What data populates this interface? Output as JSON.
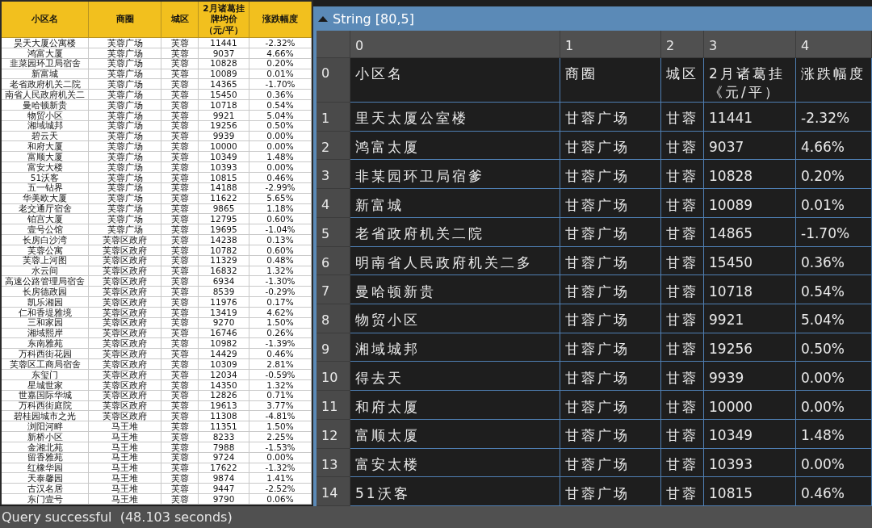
{
  "spreadsheet": {
    "columns": [
      "小区名",
      "商圈",
      "城区",
      "2月诸葛挂牌均价（元/平）",
      "涨跌幅度"
    ],
    "rows": [
      [
        "昊天大厦公寓楼",
        "芙蓉广场",
        "芙蓉",
        "11441",
        "-2.32%"
      ],
      [
        "鸿富大厦",
        "芙蓉广场",
        "芙蓉",
        "9037",
        "4.66%"
      ],
      [
        "韭菜园环卫局宿舍",
        "芙蓉广场",
        "芙蓉",
        "10828",
        "0.20%"
      ],
      [
        "新富城",
        "芙蓉广场",
        "芙蓉",
        "10089",
        "0.01%"
      ],
      [
        "老省政府机关二院",
        "芙蓉广场",
        "芙蓉",
        "14365",
        "-1.70%"
      ],
      [
        "南省人民政府机关二",
        "芙蓉广场",
        "芙蓉",
        "15450",
        "0.36%"
      ],
      [
        "曼哈顿新贵",
        "芙蓉广场",
        "芙蓉",
        "10718",
        "0.54%"
      ],
      [
        "物贸小区",
        "芙蓉广场",
        "芙蓉",
        "9921",
        "5.04%"
      ],
      [
        "湘域城邦",
        "芙蓉广场",
        "芙蓉",
        "19256",
        "0.50%"
      ],
      [
        "碧云天",
        "芙蓉广场",
        "芙蓉",
        "9939",
        "0.00%"
      ],
      [
        "和府大厦",
        "芙蓉广场",
        "芙蓉",
        "10000",
        "0.00%"
      ],
      [
        "富顺大厦",
        "芙蓉广场",
        "芙蓉",
        "10349",
        "1.48%"
      ],
      [
        "富安大楼",
        "芙蓉广场",
        "芙蓉",
        "10393",
        "0.00%"
      ],
      [
        "51沃客",
        "芙蓉广场",
        "芙蓉",
        "10815",
        "0.46%"
      ],
      [
        "五一钻界",
        "芙蓉广场",
        "芙蓉",
        "14188",
        "-2.99%"
      ],
      [
        "华美欧大厦",
        "芙蓉广场",
        "芙蓉",
        "11622",
        "5.65%"
      ],
      [
        "老交通厅宿舍",
        "芙蓉广场",
        "芙蓉",
        "9865",
        "1.18%"
      ],
      [
        "铂宫大厦",
        "芙蓉广场",
        "芙蓉",
        "12795",
        "0.60%"
      ],
      [
        "壹号公馆",
        "芙蓉广场",
        "芙蓉",
        "19695",
        "-1.04%"
      ],
      [
        "长房白沙湾",
        "芙蓉区政府",
        "芙蓉",
        "14238",
        "0.13%"
      ],
      [
        "芙蓉公寓",
        "芙蓉区政府",
        "芙蓉",
        "10782",
        "0.60%"
      ],
      [
        "芙蓉上河图",
        "芙蓉区政府",
        "芙蓉",
        "11329",
        "0.48%"
      ],
      [
        "水云间",
        "芙蓉区政府",
        "芙蓉",
        "16832",
        "1.32%"
      ],
      [
        "高速公路管理局宿舍",
        "芙蓉区政府",
        "芙蓉",
        "6934",
        "-1.30%"
      ],
      [
        "长房德政园",
        "芙蓉区政府",
        "芙蓉",
        "8539",
        "-0.29%"
      ],
      [
        "凯乐湘园",
        "芙蓉区政府",
        "芙蓉",
        "11976",
        "0.17%"
      ],
      [
        "仁和香堤雅境",
        "芙蓉区政府",
        "芙蓉",
        "13419",
        "4.62%"
      ],
      [
        "三和家园",
        "芙蓉区政府",
        "芙蓉",
        "9270",
        "1.50%"
      ],
      [
        "湘域熙岸",
        "芙蓉区政府",
        "芙蓉",
        "16746",
        "0.26%"
      ],
      [
        "东南雅苑",
        "芙蓉区政府",
        "芙蓉",
        "10982",
        "-1.39%"
      ],
      [
        "万科西街花园",
        "芙蓉区政府",
        "芙蓉",
        "14429",
        "0.46%"
      ],
      [
        "芙蓉区工商局宿舍",
        "芙蓉区政府",
        "芙蓉",
        "10309",
        "2.81%"
      ],
      [
        "东玺门",
        "芙蓉区政府",
        "芙蓉",
        "12034",
        "-0.59%"
      ],
      [
        "星城世家",
        "芙蓉区政府",
        "芙蓉",
        "14350",
        "1.32%"
      ],
      [
        "世嘉国际华城",
        "芙蓉区政府",
        "芙蓉",
        "12826",
        "0.71%"
      ],
      [
        "万科西街庭院",
        "芙蓉区政府",
        "芙蓉",
        "19613",
        "3.77%"
      ],
      [
        "碧桂园城市之光",
        "芙蓉区政府",
        "芙蓉",
        "11308",
        "-4.81%"
      ],
      [
        "浏阳河畔",
        "马王堆",
        "芙蓉",
        "11351",
        "1.50%"
      ],
      [
        "新桥小区",
        "马王堆",
        "芙蓉",
        "8233",
        "2.25%"
      ],
      [
        "金湘北苑",
        "马王堆",
        "芙蓉",
        "7988",
        "-1.53%"
      ],
      [
        "留香雅苑",
        "马王堆",
        "芙蓉",
        "9724",
        "0.00%"
      ],
      [
        "红橡华园",
        "马王堆",
        "芙蓉",
        "17622",
        "-1.32%"
      ],
      [
        "天泰馨园",
        "马王堆",
        "芙蓉",
        "9874",
        "1.41%"
      ],
      [
        "古汉名居",
        "马王堆",
        "芙蓉",
        "9447",
        "-2.52%"
      ],
      [
        "东门壹号",
        "马王堆",
        "芙蓉",
        "9790",
        "0.06%"
      ]
    ]
  },
  "result_panel": {
    "title": "String [80,5]",
    "expanded": true,
    "column_indices": [
      "0",
      "1",
      "2",
      "3",
      "4"
    ],
    "rows": [
      {
        "index": "0",
        "cells": [
          "小区名",
          "商圈",
          "城区",
          "2月诸葛挂《元/平）",
          "涨跌幅度"
        ]
      },
      {
        "index": "1",
        "cells": [
          "里天太厦公室楼",
          "甘蓉广场",
          "甘蓉",
          "11441",
          "-2.32%"
        ]
      },
      {
        "index": "2",
        "cells": [
          "鸿富太厦",
          "甘蓉广场",
          "甘蓉",
          "9037",
          "4.66%"
        ]
      },
      {
        "index": "3",
        "cells": [
          "非某园环卫局宿爹",
          "甘蓉广场",
          "甘蓉",
          "10828",
          "0.20%"
        ]
      },
      {
        "index": "4",
        "cells": [
          "新富城",
          "甘蓉广场",
          "甘蓉",
          "10089",
          "0.01%"
        ]
      },
      {
        "index": "5",
        "cells": [
          "老省政府机关二院",
          "甘蓉广场",
          "甘蓉",
          "14865",
          "-1.70%"
        ]
      },
      {
        "index": "6",
        "cells": [
          "明南省人民政府机关二多",
          "甘蓉广场",
          "甘蓉",
          "15450",
          "0.36%"
        ]
      },
      {
        "index": "7",
        "cells": [
          "曼哈顿新贵",
          "甘蓉广场",
          "甘蓉",
          "10718",
          "0.54%"
        ]
      },
      {
        "index": "8",
        "cells": [
          "物贸小区",
          "甘蓉广场",
          "甘蓉",
          "9921",
          "5.04%"
        ]
      },
      {
        "index": "9",
        "cells": [
          "湘域城邦",
          "甘蓉广场",
          "甘蓉",
          "19256",
          "0.50%"
        ]
      },
      {
        "index": "10",
        "cells": [
          "得去天",
          "甘蓉广场",
          "甘蓉",
          "9939",
          "0.00%"
        ]
      },
      {
        "index": "11",
        "cells": [
          "和府太厦",
          "甘蓉广场",
          "甘蓉",
          "10000",
          "0.00%"
        ]
      },
      {
        "index": "12",
        "cells": [
          "富顺太厦",
          "甘蓉广场",
          "甘蓉",
          "10349",
          "1.48%"
        ]
      },
      {
        "index": "13",
        "cells": [
          "富安太楼",
          "甘蓉广场",
          "甘蓉",
          "10393",
          "0.00%"
        ]
      },
      {
        "index": "14",
        "cells": [
          "51沃客",
          "甘蓉广场",
          "甘蓉",
          "10815",
          "0.46%"
        ]
      }
    ]
  },
  "status_bar": "Query successful  (48.103 seconds)"
}
